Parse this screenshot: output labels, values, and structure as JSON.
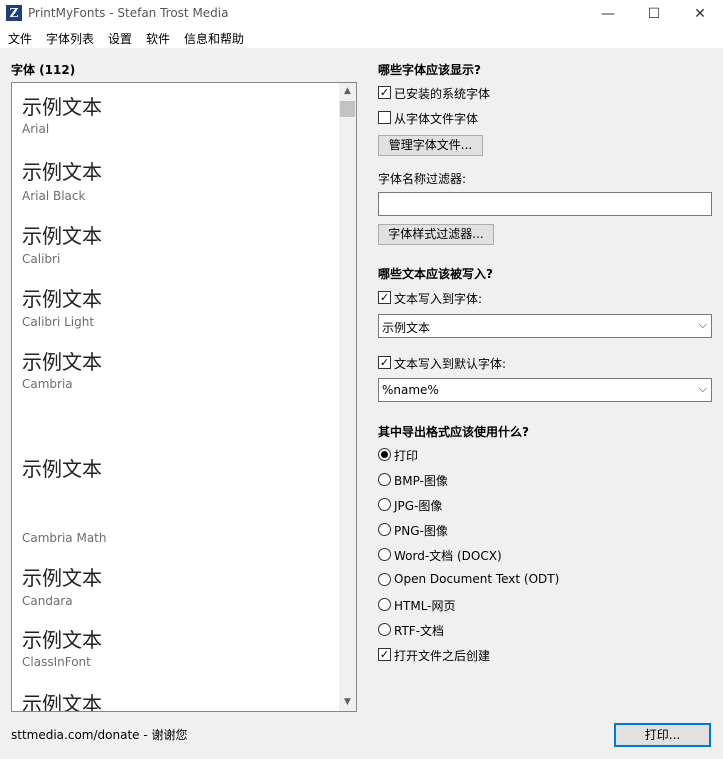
{
  "window": {
    "title": "PrintMyFonts - Stefan Trost Media"
  },
  "menu": [
    "文件",
    "字体列表",
    "设置",
    "软件",
    "信息和帮助"
  ],
  "font_panel": {
    "header": "字体 (112)",
    "items": [
      {
        "sample": "示例文本",
        "name": "Arial"
      },
      {
        "sample": "示例文本",
        "name": "Arial Black"
      },
      {
        "sample": "示例文本",
        "name": "Calibri"
      },
      {
        "sample": "示例文本",
        "name": "Calibri Light"
      },
      {
        "sample": "示例文本",
        "name": "Cambria"
      },
      {
        "sample": "示例文本",
        "name": "Cambria Math"
      },
      {
        "sample": "示例文本",
        "name": "Candara"
      },
      {
        "sample": "示例文本",
        "name": "ClassInFont"
      },
      {
        "sample": "示例文本",
        "name": ""
      }
    ]
  },
  "which_fonts": {
    "heading": "哪些字体应该显示?",
    "installed_label": "已安装的系统字体",
    "installed_checked": true,
    "from_file_label": "从字体文件字体",
    "from_file_checked": false,
    "manage_button": "管理字体文件...",
    "name_filter_label": "字体名称过滤器:",
    "name_filter_value": "",
    "style_filter_button": "字体样式过滤器..."
  },
  "which_text": {
    "heading": "哪些文本应该被写入?",
    "write_to_font_label": "文本写入到字体:",
    "write_to_font_checked": true,
    "write_to_font_value": "示例文本",
    "write_to_default_label": "文本写入到默认字体:",
    "write_to_default_checked": true,
    "write_to_default_value": "%name%"
  },
  "export": {
    "heading": "其中导出格式应该使用什么?",
    "options": [
      "打印",
      "BMP-图像",
      "JPG-图像",
      "PNG-图像",
      "Word-文档 (DOCX)",
      "Open Document Text (ODT)",
      "HTML-网页",
      "RTF-文档"
    ],
    "selected_index": 0,
    "open_after_label": "打开文件之后创建",
    "open_after_checked": true
  },
  "footer": {
    "donate_text": "sttmedia.com/donate - 谢谢您",
    "print_button": "打印..."
  }
}
